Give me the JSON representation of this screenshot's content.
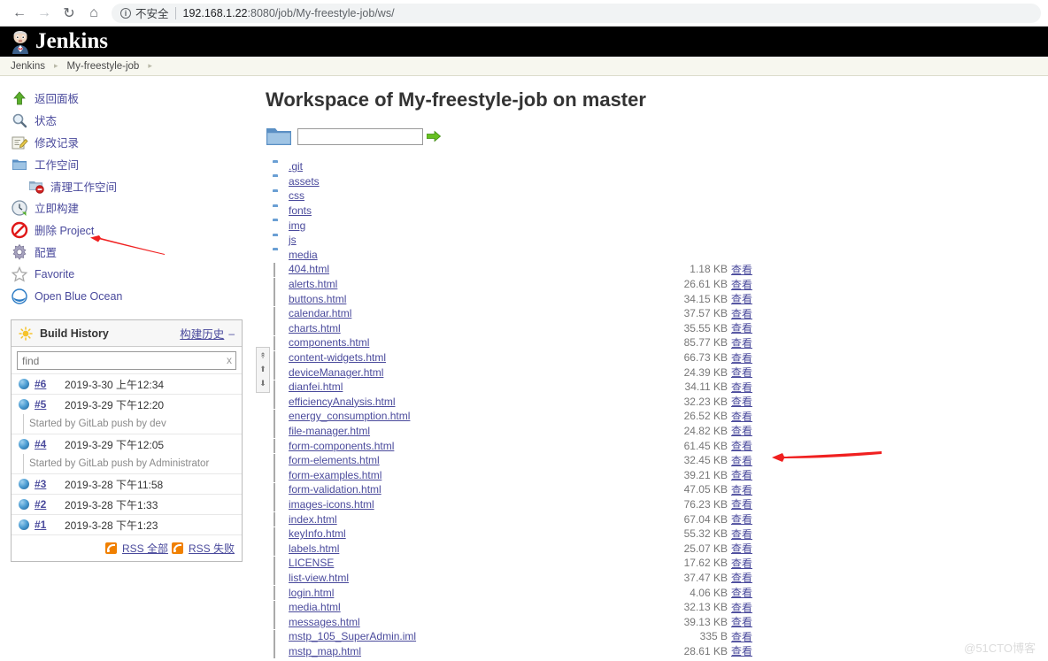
{
  "browser": {
    "back_icon": "arrow-left-icon",
    "forward_icon": "arrow-right-icon",
    "reload_icon": "reload-icon",
    "home_icon": "home-icon",
    "info_icon": "info-icon",
    "security_label": "不安全",
    "url_host": "192.168.1.22",
    "url_path": ":8080/job/My-freestyle-job/ws/"
  },
  "header": {
    "title": "Jenkins",
    "logo_icon": "jenkins-butler-icon"
  },
  "breadcrumb": {
    "items": [
      "Jenkins",
      "My-freestyle-job"
    ],
    "separator": "▸"
  },
  "sidebar": {
    "tasks": [
      {
        "label": "返回面板",
        "icon": "up-arrow-green-icon"
      },
      {
        "label": "状态",
        "icon": "magnifier-icon"
      },
      {
        "label": "修改记录",
        "icon": "edit-notes-icon"
      },
      {
        "label": "工作空间",
        "icon": "folder-blue-icon"
      },
      {
        "label": "清理工作空间",
        "icon": "folder-delete-icon",
        "sub": true
      },
      {
        "label": "立即构建",
        "icon": "build-clock-icon"
      },
      {
        "label": "删除 Project",
        "icon": "no-entry-icon"
      },
      {
        "label": "配置",
        "icon": "gear-icon"
      },
      {
        "label": "Favorite",
        "icon": "star-outline-icon"
      },
      {
        "label": "Open Blue Ocean",
        "icon": "blue-ocean-icon"
      }
    ]
  },
  "build_history": {
    "icon": "sun-icon",
    "title": "Build History",
    "title_cn": "构建历史",
    "collapse_icon": "minus-icon",
    "find_placeholder": "find",
    "find_value": "",
    "find_clear": "x",
    "scroll_icons": [
      "scroll-top-icon",
      "scroll-up-icon",
      "scroll-down-icon"
    ],
    "builds": [
      {
        "number": "#6",
        "date": "2019-3-30 上午12:34",
        "cause": null
      },
      {
        "number": "#5",
        "date": "2019-3-29 下午12:20",
        "cause": "Started by GitLab push by dev"
      },
      {
        "number": "#4",
        "date": "2019-3-29 下午12:05",
        "cause": "Started by GitLab push by Administrator"
      },
      {
        "number": "#3",
        "date": "2019-3-28 下午11:58",
        "cause": null
      },
      {
        "number": "#2",
        "date": "2019-3-28 下午1:33",
        "cause": null
      },
      {
        "number": "#1",
        "date": "2019-3-28 下午1:23",
        "cause": null
      }
    ],
    "rss_all": "RSS 全部",
    "rss_failed": "RSS 失败",
    "rss_icon": "rss-icon"
  },
  "main": {
    "title": "Workspace of My-freestyle-job on master",
    "path_folder_icon": "folder-large-icon",
    "path_input_value": "",
    "path_input_placeholder": "",
    "go_icon": "green-arrow-right-icon",
    "view_label": "查看",
    "files": [
      {
        "name": ".git",
        "type": "folder",
        "size": null
      },
      {
        "name": "assets",
        "type": "folder",
        "size": null
      },
      {
        "name": "css",
        "type": "folder",
        "size": null
      },
      {
        "name": "fonts",
        "type": "folder",
        "size": null
      },
      {
        "name": "img",
        "type": "folder",
        "size": null
      },
      {
        "name": "js",
        "type": "folder",
        "size": null
      },
      {
        "name": "media",
        "type": "folder",
        "size": null
      },
      {
        "name": "404.html",
        "type": "file",
        "size": "1.18 KB"
      },
      {
        "name": "alerts.html",
        "type": "file",
        "size": "26.61 KB"
      },
      {
        "name": "buttons.html",
        "type": "file",
        "size": "34.15 KB"
      },
      {
        "name": "calendar.html",
        "type": "file",
        "size": "37.57 KB"
      },
      {
        "name": "charts.html",
        "type": "file",
        "size": "35.55 KB"
      },
      {
        "name": "components.html",
        "type": "file",
        "size": "85.77 KB"
      },
      {
        "name": "content-widgets.html",
        "type": "file",
        "size": "66.73 KB"
      },
      {
        "name": "deviceManager.html",
        "type": "file",
        "size": "24.39 KB"
      },
      {
        "name": "dianfei.html",
        "type": "file",
        "size": "34.11 KB"
      },
      {
        "name": "efficiencyAnalysis.html",
        "type": "file",
        "size": "32.23 KB"
      },
      {
        "name": "energy_consumption.html",
        "type": "file",
        "size": "26.52 KB"
      },
      {
        "name": "file-manager.html",
        "type": "file",
        "size": "24.82 KB"
      },
      {
        "name": "form-components.html",
        "type": "file",
        "size": "61.45 KB"
      },
      {
        "name": "form-elements.html",
        "type": "file",
        "size": "32.45 KB"
      },
      {
        "name": "form-examples.html",
        "type": "file",
        "size": "39.21 KB"
      },
      {
        "name": "form-validation.html",
        "type": "file",
        "size": "47.05 KB"
      },
      {
        "name": "images-icons.html",
        "type": "file",
        "size": "76.23 KB"
      },
      {
        "name": "index.html",
        "type": "file",
        "size": "67.04 KB"
      },
      {
        "name": "keyInfo.html",
        "type": "file",
        "size": "55.32 KB"
      },
      {
        "name": "labels.html",
        "type": "file",
        "size": "25.07 KB"
      },
      {
        "name": "LICENSE",
        "type": "file",
        "size": "17.62 KB"
      },
      {
        "name": "list-view.html",
        "type": "file",
        "size": "37.47 KB"
      },
      {
        "name": "login.html",
        "type": "file",
        "size": "4.06 KB"
      },
      {
        "name": "media.html",
        "type": "file",
        "size": "32.13 KB"
      },
      {
        "name": "messages.html",
        "type": "file",
        "size": "39.13 KB"
      },
      {
        "name": "mstp_105_SuperAdmin.iml",
        "type": "file",
        "size": "335 B"
      },
      {
        "name": "mstp_map.html",
        "type": "file",
        "size": "28.61 KB"
      }
    ]
  },
  "annotations": {
    "arrows": [
      "red-arrow-pointing-to-workspace-link",
      "red-arrow-pointing-to-file-list"
    ],
    "watermark": "@51CTO博客"
  }
}
